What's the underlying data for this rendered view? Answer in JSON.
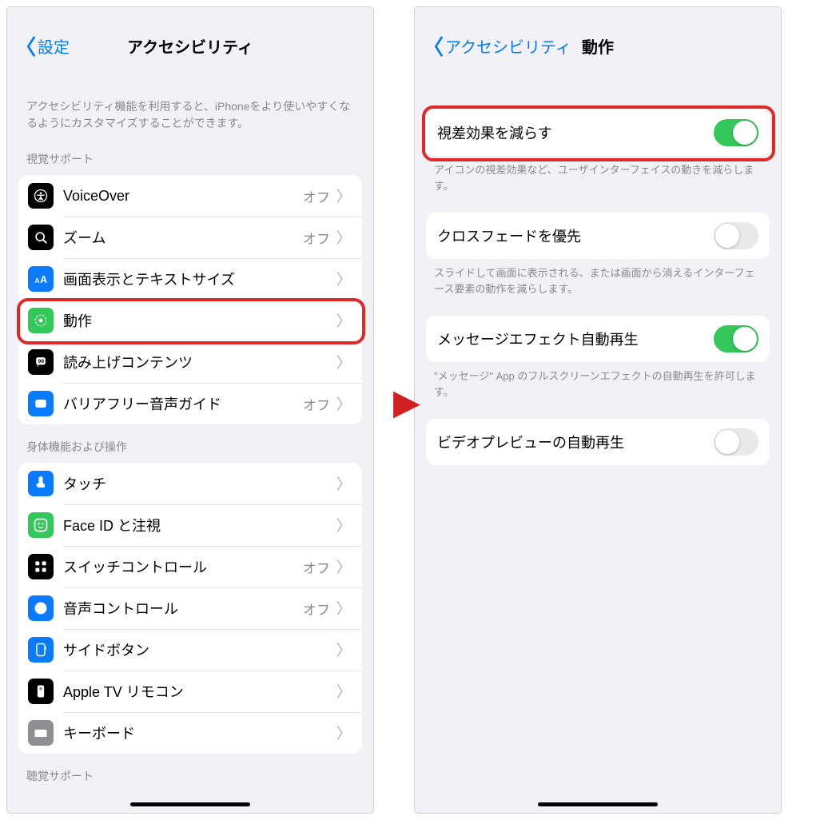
{
  "left": {
    "back": "設定",
    "title": "アクセシビリティ",
    "intro": "アクセシビリティ機能を利用すると、iPhoneをより使いやすくなるようにカスタマイズすることができます。",
    "sections": {
      "vision_label": "視覚サポート",
      "vision": [
        {
          "name": "voiceover",
          "label": "VoiceOver",
          "status": "オフ",
          "icon": "accessibility",
          "bg": "#000000",
          "fg": "#ffffff"
        },
        {
          "name": "zoom",
          "label": "ズーム",
          "status": "オフ",
          "icon": "zoom",
          "bg": "#000000",
          "fg": "#ffffff"
        },
        {
          "name": "display",
          "label": "画面表示とテキストサイズ",
          "status": "",
          "icon": "textsize",
          "bg": "#0a7aff",
          "fg": "#ffffff"
        },
        {
          "name": "motion",
          "label": "動作",
          "status": "",
          "icon": "motion",
          "bg": "#34c759",
          "fg": "#ffffff",
          "highlight": true
        },
        {
          "name": "spoken",
          "label": "読み上げコンテンツ",
          "status": "",
          "icon": "speech",
          "bg": "#000000",
          "fg": "#ffffff"
        },
        {
          "name": "audiodesc",
          "label": "バリアフリー音声ガイド",
          "status": "オフ",
          "icon": "audiodesc",
          "bg": "#0a7aff",
          "fg": "#ffffff"
        }
      ],
      "physical_label": "身体機能および操作",
      "physical": [
        {
          "name": "touch",
          "label": "タッチ",
          "status": "",
          "icon": "touch",
          "bg": "#0a7aff",
          "fg": "#ffffff"
        },
        {
          "name": "faceid",
          "label": "Face ID と注視",
          "status": "",
          "icon": "faceid",
          "bg": "#34c759",
          "fg": "#ffffff"
        },
        {
          "name": "switch",
          "label": "スイッチコントロール",
          "status": "オフ",
          "icon": "grid",
          "bg": "#000000",
          "fg": "#ffffff"
        },
        {
          "name": "voicectl",
          "label": "音声コントロール",
          "status": "オフ",
          "icon": "voicectl",
          "bg": "#0a7aff",
          "fg": "#ffffff"
        },
        {
          "name": "sidebtn",
          "label": "サイドボタン",
          "status": "",
          "icon": "sidebtn",
          "bg": "#0a7aff",
          "fg": "#ffffff"
        },
        {
          "name": "appletv",
          "label": "Apple TV リモコン",
          "status": "",
          "icon": "appletv",
          "bg": "#000000",
          "fg": "#ffffff"
        },
        {
          "name": "keyboard",
          "label": "キーボード",
          "status": "",
          "icon": "keyboard",
          "bg": "#8e8e93",
          "fg": "#ffffff"
        }
      ],
      "hearing_label": "聴覚サポート"
    }
  },
  "right": {
    "back": "アクセシビリティ",
    "title": "動作",
    "rows": [
      {
        "name": "reduce-motion",
        "label": "視差効果を減らす",
        "on": true,
        "highlight": true,
        "footer": "アイコンの視差効果など、ユーザインターフェイスの動きを減らします。"
      },
      {
        "name": "crossfade",
        "label": "クロスフェードを優先",
        "on": false,
        "footer": "スライドして画面に表示される、または画面から消えるインターフェース要素の動作を減らします。"
      },
      {
        "name": "msg-effects",
        "label": "メッセージエフェクト自動再生",
        "on": true,
        "footer": "\"メッセージ\" App のフルスクリーンエフェクトの自動再生を許可します。"
      },
      {
        "name": "video-preview",
        "label": "ビデオプレビューの自動再生",
        "on": false,
        "footer": ""
      }
    ]
  },
  "arrow_color": "#d21f1f",
  "highlight_color": "#e12828"
}
